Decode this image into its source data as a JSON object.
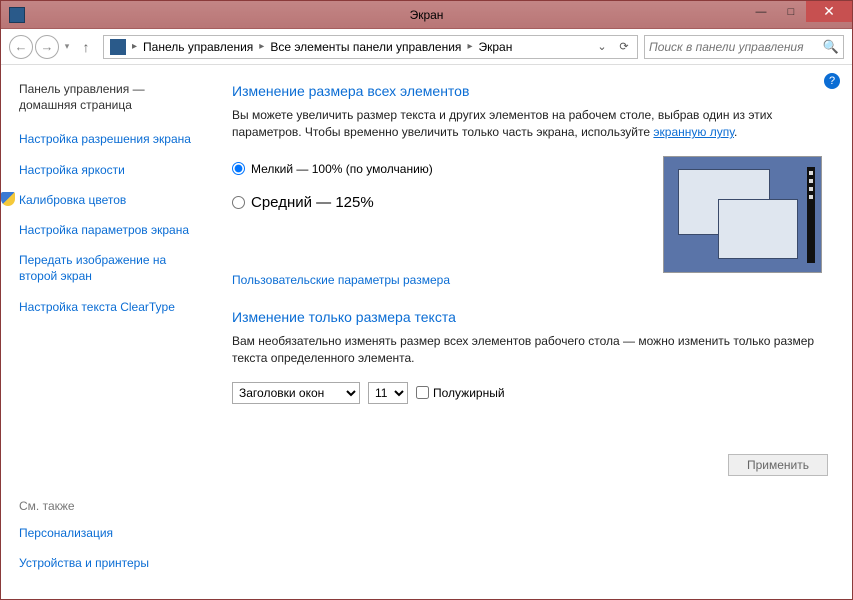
{
  "window": {
    "title": "Экран"
  },
  "nav": {
    "crumb1": "Панель управления",
    "crumb2": "Все элементы панели управления",
    "crumb3": "Экран",
    "search_placeholder": "Поиск в панели управления"
  },
  "sidebar": {
    "home": "Панель управления — домашняя страница",
    "link_resolution": "Настройка разрешения экрана",
    "link_brightness": "Настройка яркости",
    "link_calibration": "Калибровка цветов",
    "link_params": "Настройка параметров экрана",
    "link_project": "Передать изображение на второй экран",
    "link_cleartype": "Настройка текста ClearType",
    "see_also": "См. также",
    "link_personalization": "Персонализация",
    "link_devices": "Устройства и принтеры"
  },
  "main": {
    "heading1": "Изменение размера всех элементов",
    "desc1_a": "Вы можете увеличить размер текста и других элементов на рабочем столе, выбрав один из этих параметров. Чтобы временно увеличить только часть экрана, используйте ",
    "desc1_link": "экранную лупу",
    "desc1_b": ".",
    "radio_small": "Мелкий — 100% (по умолчанию)",
    "radio_medium": "Средний — 125%",
    "custom_link": "Пользовательские параметры размера",
    "heading2": "Изменение только размера текста",
    "desc2": "Вам необязательно изменять размер всех элементов рабочего стола — можно изменить только размер текста определенного элемента.",
    "select_elem": "Заголовки окон",
    "select_size": "11",
    "checkbox_bold": "Полужирный",
    "apply": "Применить"
  }
}
